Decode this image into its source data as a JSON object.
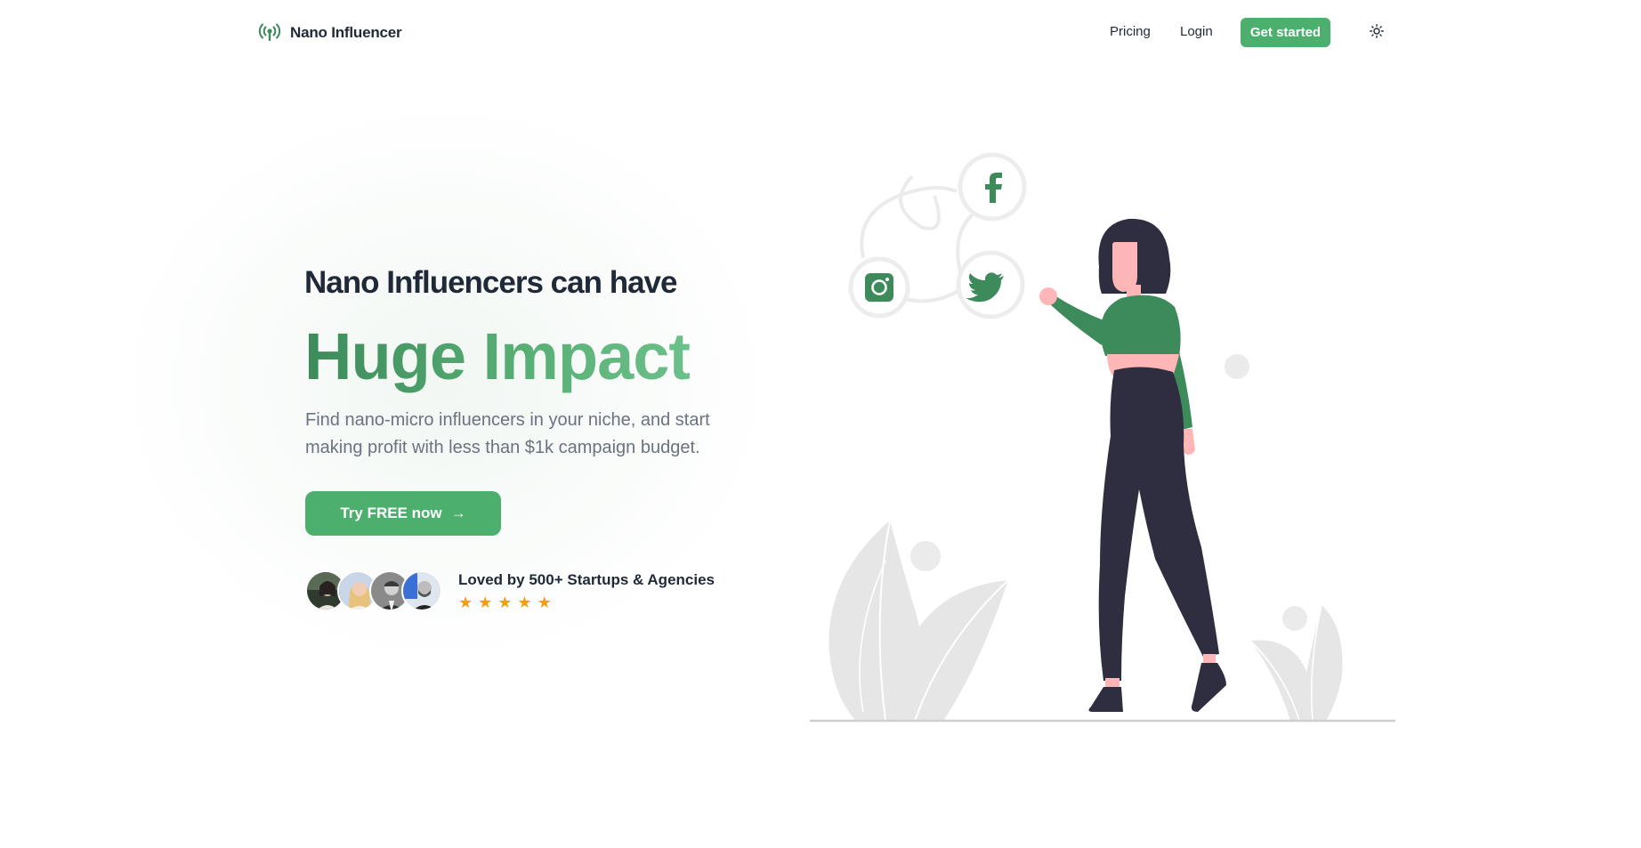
{
  "nav": {
    "brand_name": "Nano Influencer",
    "links": {
      "pricing": "Pricing",
      "login": "Login"
    },
    "cta": "Get started"
  },
  "hero": {
    "subtitle": "Nano Influencers can have",
    "title": "Huge Impact",
    "description": "Find nano-micro influencers in your niche, and start making profit with less than $1k campaign budget.",
    "cta": "Try FREE now",
    "cta_arrow": "→"
  },
  "social_proof": {
    "text": "Loved by 500+ Startups & Agencies",
    "rating": 5,
    "star_glyph": "★"
  },
  "colors": {
    "accent": "#4caf6e",
    "accent_dark": "#3d8a5b",
    "text": "#1f2937",
    "muted": "#6b7280",
    "star": "#f59e0b",
    "figure_pants": "#2f2e41",
    "figure_skin": "#ffb6b6",
    "leaf_gray": "#e6e6e6"
  },
  "icons": [
    "broadcast-icon",
    "sun-icon",
    "arrow-right-icon",
    "facebook-icon",
    "twitter-icon",
    "instagram-icon",
    "star-icon"
  ]
}
